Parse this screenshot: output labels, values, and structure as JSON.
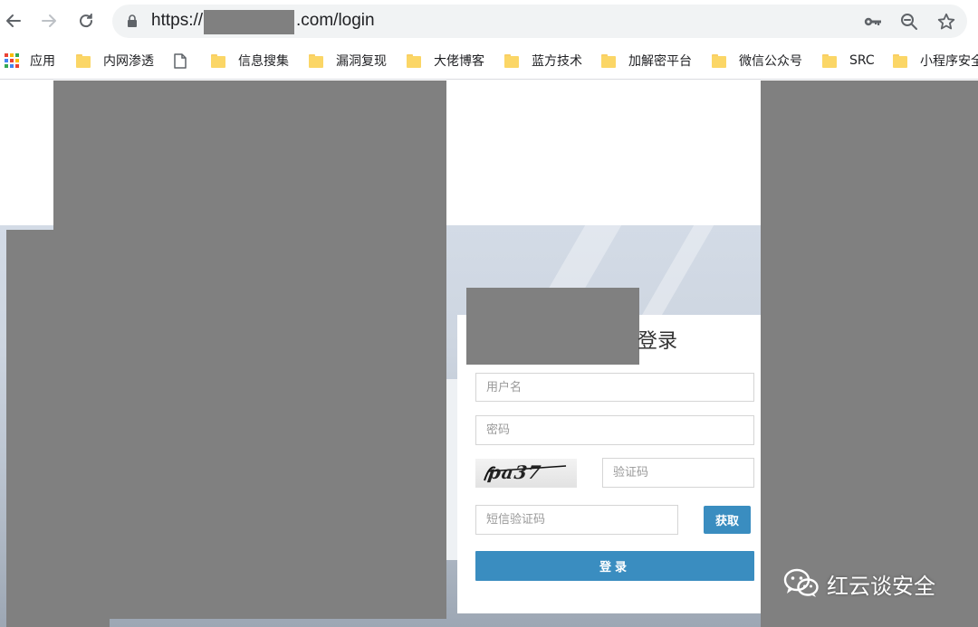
{
  "browser": {
    "url_prefix": "https://",
    "url_suffix": ".com/login",
    "icons": [
      "back-icon",
      "forward-icon",
      "reload-icon",
      "lock-icon",
      "key-icon",
      "zoom-out-icon",
      "star-icon"
    ]
  },
  "bookmarks": {
    "apps_label": "应用",
    "items": [
      {
        "label": "内网渗透",
        "icon": "folder-icon"
      },
      {
        "label": "",
        "icon": "page-icon"
      },
      {
        "label": "信息搜集",
        "icon": "folder-icon"
      },
      {
        "label": "漏洞复现",
        "icon": "folder-icon"
      },
      {
        "label": "大佬博客",
        "icon": "folder-icon"
      },
      {
        "label": "蓝方技术",
        "icon": "folder-icon"
      },
      {
        "label": "加解密平台",
        "icon": "folder-icon"
      },
      {
        "label": "微信公众号",
        "icon": "folder-icon"
      },
      {
        "label": "SRC",
        "icon": "folder-icon"
      },
      {
        "label": "小程序安全",
        "icon": "folder-icon"
      }
    ]
  },
  "login": {
    "title": "登录",
    "username_placeholder": "用户名",
    "password_placeholder": "密码",
    "captcha_text": "pa37",
    "captcha_placeholder": "验证码",
    "sms_placeholder": "短信验证码",
    "sms_button": "获取",
    "submit_button": "登录"
  },
  "watermark": {
    "text": "红云谈安全",
    "icon": "wechat-icon"
  },
  "colors": {
    "primary_button": "#3a8dc0",
    "redaction": "#808080",
    "omnibox": "#f1f3f4"
  }
}
